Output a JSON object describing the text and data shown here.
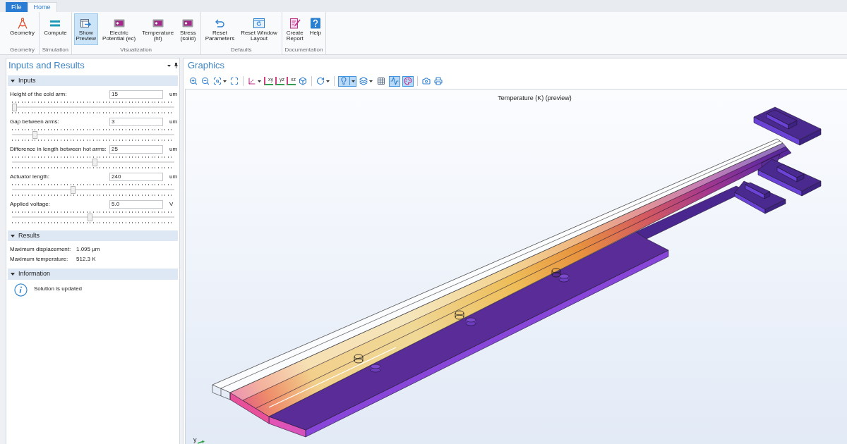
{
  "tabs": [
    {
      "label": "File",
      "kind": "file",
      "selected": false
    },
    {
      "label": "Home",
      "kind": "tab",
      "selected": true
    }
  ],
  "ribbon": {
    "groups": [
      {
        "label": "Geometry",
        "buttons": [
          {
            "lines": [
              "Geometry"
            ],
            "selected": false
          }
        ]
      },
      {
        "label": "Simulation",
        "buttons": [
          {
            "lines": [
              "Compute"
            ],
            "selected": false
          }
        ]
      },
      {
        "label": "Visualization",
        "buttons": [
          {
            "lines": [
              "Show",
              "Preview"
            ],
            "selected": true
          },
          {
            "lines": [
              "Electric",
              "Potential (ec)"
            ],
            "selected": false
          },
          {
            "lines": [
              "Temperature",
              "(ht)"
            ],
            "selected": false
          },
          {
            "lines": [
              "Stress",
              "(solid)"
            ],
            "selected": false
          }
        ]
      },
      {
        "label": "Defaults",
        "buttons": [
          {
            "lines": [
              "Reset",
              "Parameters"
            ],
            "selected": false
          },
          {
            "lines": [
              "Reset Window",
              "Layout"
            ],
            "selected": false
          }
        ]
      },
      {
        "label": "Documentation",
        "buttons": [
          {
            "lines": [
              "Create",
              "Report"
            ],
            "selected": false
          },
          {
            "lines": [
              "Help"
            ],
            "selected": false
          }
        ]
      }
    ]
  },
  "inputs_panel": {
    "title": "Inputs and Results",
    "sections": [
      {
        "kind": "inputs",
        "title": "Inputs",
        "expanded": true,
        "parameters": [
          {
            "label": "Height of the cold arm:",
            "value": "15",
            "unit": "um",
            "level": 0.0
          },
          {
            "label": "Gap between arms:",
            "value": "3",
            "unit": "um",
            "level": 0.13
          },
          {
            "label": "Difference in length between hot arms:",
            "value": "25",
            "unit": "um",
            "level": 0.51
          },
          {
            "label": "Actuator length:",
            "value": "240",
            "unit": "um",
            "level": 0.37
          },
          {
            "label": "Applied voltage:",
            "value": "5.0",
            "unit": "V",
            "level": 0.48
          }
        ]
      },
      {
        "kind": "results",
        "title": "Results",
        "expanded": true,
        "rows": [
          {
            "label": "Maximum displacement:",
            "value": "1.095 µm"
          },
          {
            "label": "Maximum temperature:",
            "value": "512.3 K"
          }
        ]
      },
      {
        "kind": "info",
        "title": "Information",
        "expanded": true,
        "message": "Solution is updated"
      }
    ]
  },
  "graphics": {
    "title": "Graphics",
    "toolbar": [
      {
        "kind": "tool"
      },
      {
        "kind": "tool"
      },
      {
        "kind": "menu"
      },
      {
        "kind": "tool"
      },
      {
        "kind": "separator"
      },
      {
        "kind": "menu"
      },
      {
        "kind": "view",
        "label": "xy"
      },
      {
        "kind": "view",
        "label": "yz"
      },
      {
        "kind": "view",
        "label": "xz"
      },
      {
        "kind": "tool"
      },
      {
        "kind": "separator"
      },
      {
        "kind": "menu"
      },
      {
        "kind": "separator"
      },
      {
        "kind": "toggle_menu",
        "selected": true
      },
      {
        "kind": "menu"
      },
      {
        "kind": "toggle",
        "selected": false
      },
      {
        "kind": "toggle",
        "selected": true
      },
      {
        "kind": "toggle",
        "selected": true
      },
      {
        "kind": "separator"
      },
      {
        "kind": "tool"
      },
      {
        "kind": "tool"
      }
    ],
    "plot_title": "Temperature (K) (preview)",
    "axis_label": "y"
  }
}
